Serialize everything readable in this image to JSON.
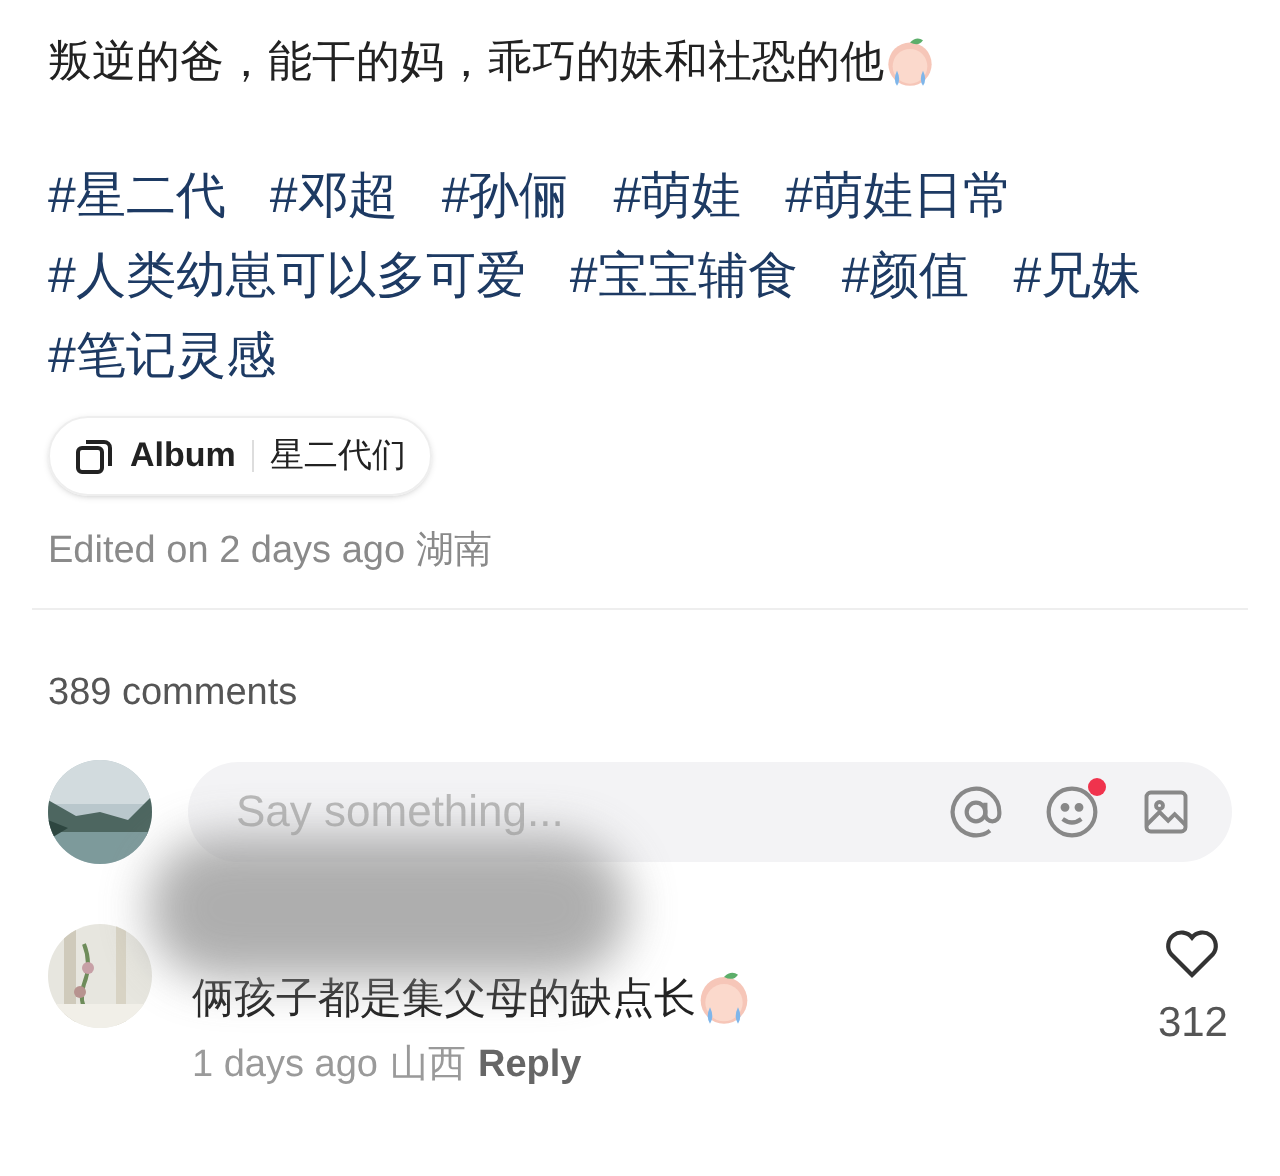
{
  "post": {
    "text": "叛逆的爸，能干的妈，乖巧的妹和社恐的他",
    "hashtags": [
      "#星二代",
      "#邓超",
      "#孙俪",
      "#萌娃",
      "#萌娃日常",
      "#人类幼崽可以多可爱",
      "#宝宝辅食",
      "#颜值",
      "#兄妹",
      "#笔记灵感"
    ],
    "album": {
      "label": "Album",
      "name": "星二代们"
    },
    "edited": "Edited on 2 days ago 湖南"
  },
  "comments_count": "389 comments",
  "comment_input": {
    "placeholder": "Say something...",
    "emoji_notification": true
  },
  "comments": [
    {
      "text": "俩孩子都是集父母的缺点长",
      "time": "1 days ago",
      "location": "山西",
      "reply": "Reply",
      "likes": "312",
      "liked": false
    }
  ]
}
